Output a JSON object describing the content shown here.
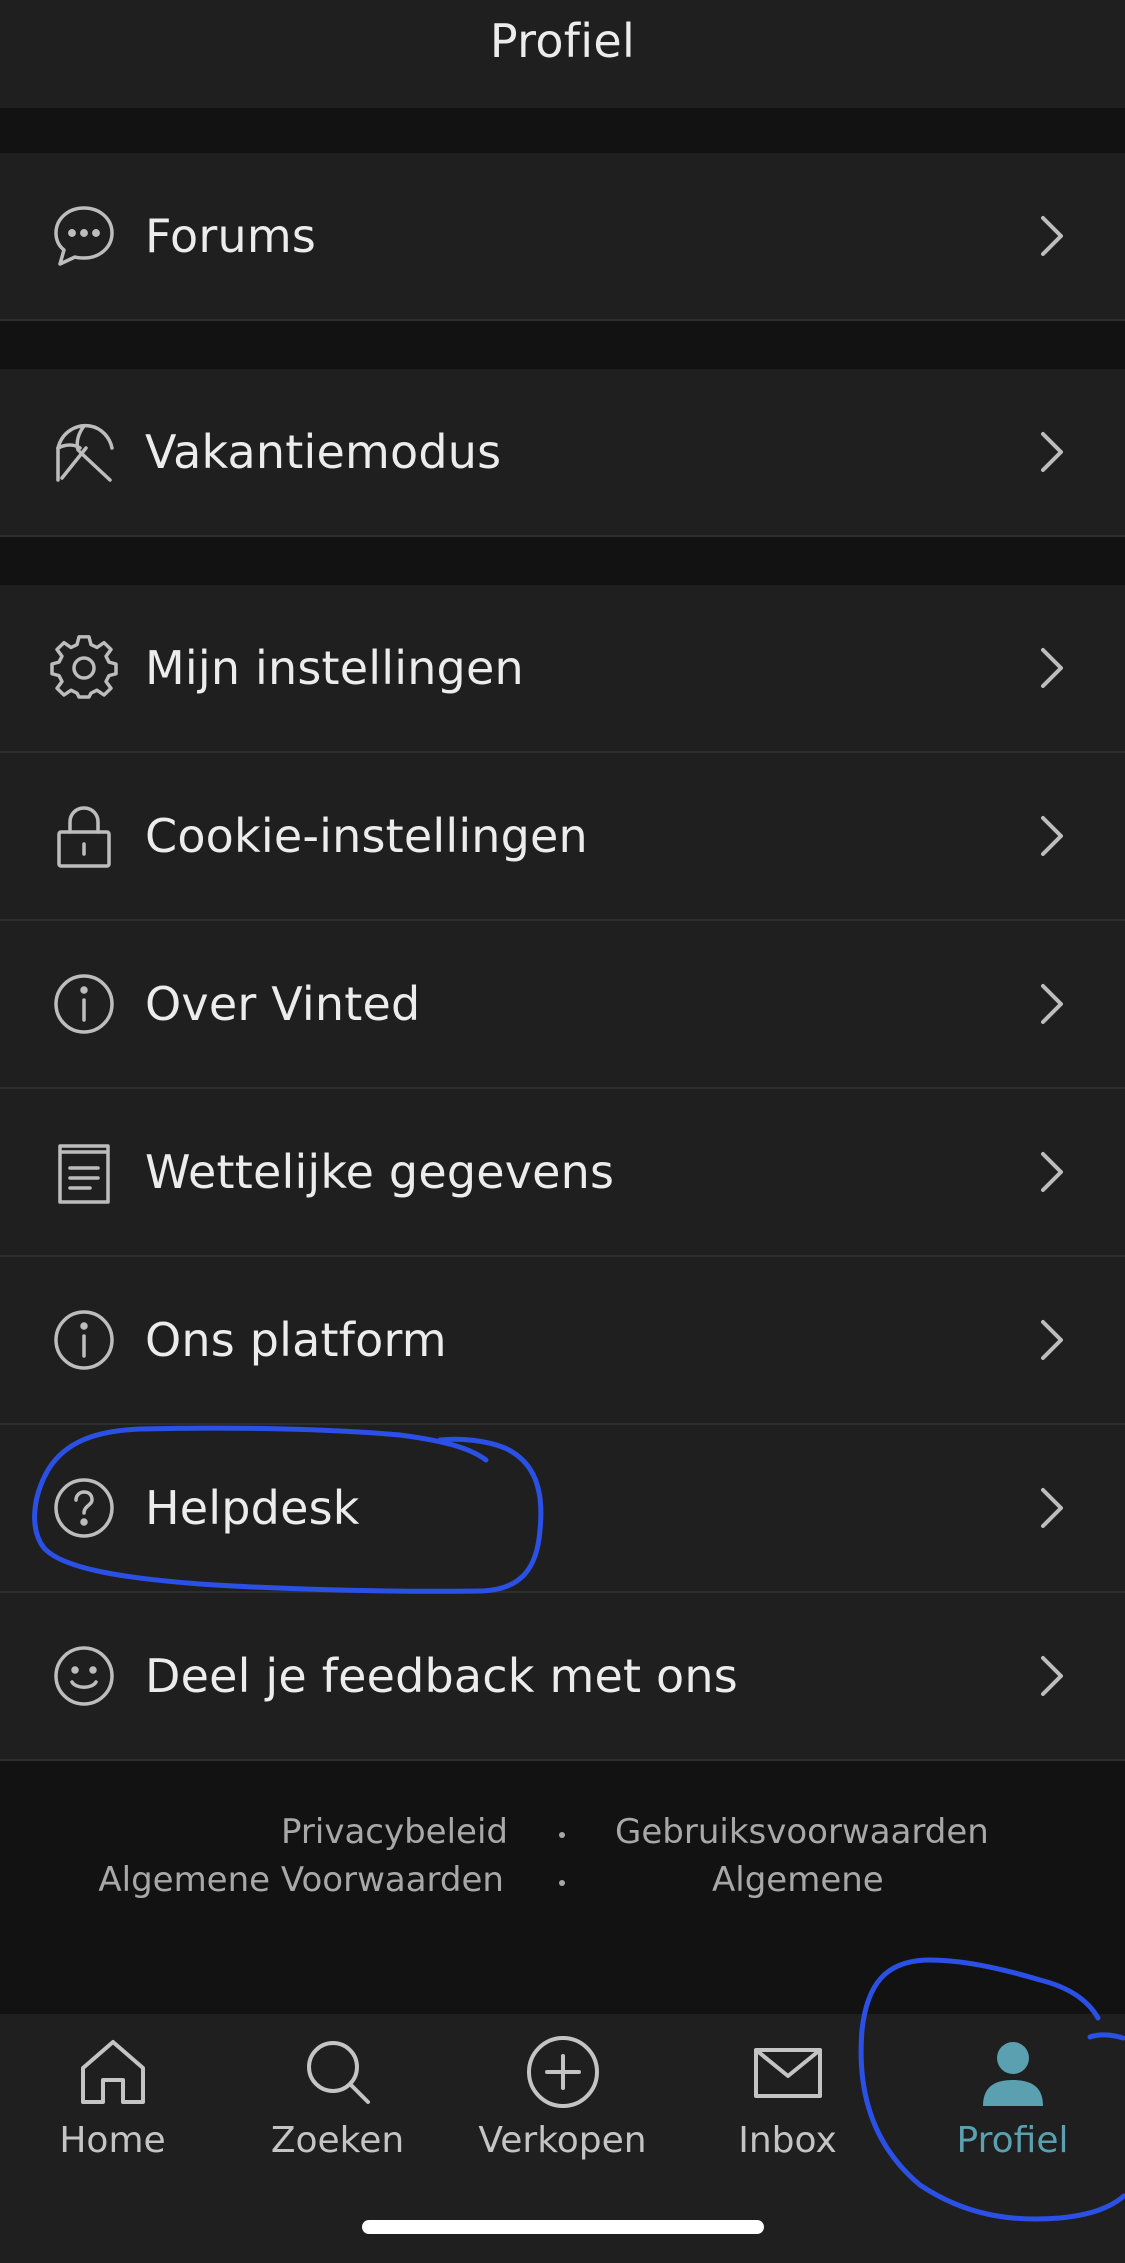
{
  "header": {
    "title": "Profiel"
  },
  "menu": {
    "forums": "Forums",
    "vacation": "Vakantiemodus",
    "settings": "Mijn instellingen",
    "cookies": "Cookie-instellingen",
    "about": "Over Vinted",
    "legal": "Wettelijke gegevens",
    "platform": "Ons platform",
    "helpdesk": "Helpdesk",
    "feedback": "Deel je feedback met ons"
  },
  "footer": {
    "privacy": "Privacybeleid",
    "terms_of_use": "Gebruiksvoorwaarden",
    "general_terms": "Algemene Voorwaarden",
    "general": "Algemene"
  },
  "tabs": {
    "home": "Home",
    "search": "Zoeken",
    "sell": "Verkopen",
    "inbox": "Inbox",
    "profile": "Profiel"
  },
  "colors": {
    "background": "#121212",
    "surface": "#1f1f1f",
    "active_tab": "#5aa0b0",
    "annotation": "#2b50e6"
  },
  "icons": {
    "forums": "chat-bubble-icon",
    "vacation": "umbrella-off-icon",
    "settings": "gear-icon",
    "cookies": "lock-icon",
    "about": "info-icon",
    "legal": "document-icon",
    "platform": "info-icon",
    "helpdesk": "question-icon",
    "feedback": "smiley-icon"
  }
}
